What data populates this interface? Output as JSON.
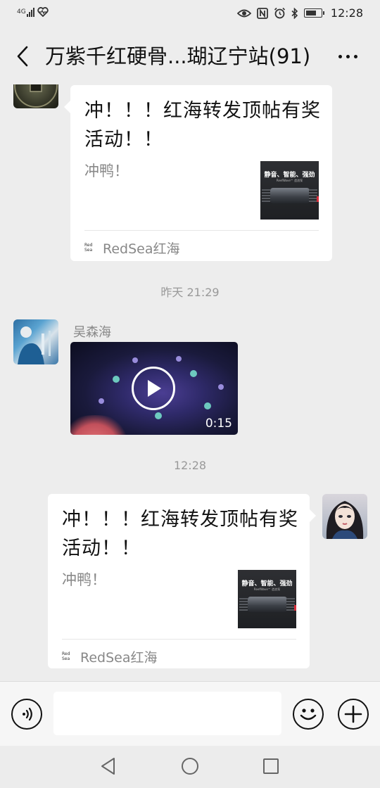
{
  "status_bar": {
    "network": "4G",
    "time": "12:28",
    "battery_level": 0.7,
    "icons": [
      "signal-icon",
      "heart-icon",
      "eye-icon",
      "nfc-icon",
      "alarm-icon",
      "bluetooth-icon",
      "battery-icon"
    ]
  },
  "nav": {
    "title": "万紫千红硬骨...瑚辽宁站(91)",
    "back_icon": "chevron-left-icon",
    "more_icon": "more-dots-icon"
  },
  "messages": [
    {
      "type": "link-card",
      "direction": "incoming",
      "title": "冲！！！红海转发顶帖有奖活动！！",
      "description": "冲鸭！",
      "thumbnail_text": "静音、智能、强劲",
      "thumbnail_subtext": "ReefWave™ 造浪泵",
      "source_logo": "Red Sea",
      "source": "RedSea红海"
    },
    {
      "type": "timestamp",
      "text": "昨天 21:29"
    },
    {
      "type": "video",
      "direction": "incoming",
      "sender": "吴森海",
      "duration": "0:15"
    },
    {
      "type": "timestamp",
      "text": "12:28"
    },
    {
      "type": "link-card",
      "direction": "outgoing",
      "title": "冲！！！红海转发顶帖有奖活动！！",
      "description": "冲鸭！",
      "thumbnail_text": "静音、智能、强劲",
      "thumbnail_subtext": "ReefWave™ 造浪泵",
      "source_logo": "Red Sea",
      "source": "RedSea红海"
    }
  ],
  "input_bar": {
    "placeholder": "",
    "voice_icon": "voice-icon",
    "emoji_icon": "emoji-icon",
    "plus_icon": "plus-icon"
  },
  "system_nav": {
    "back_icon": "triangle-back-icon",
    "home_icon": "circle-home-icon",
    "recent_icon": "square-recent-icon"
  }
}
